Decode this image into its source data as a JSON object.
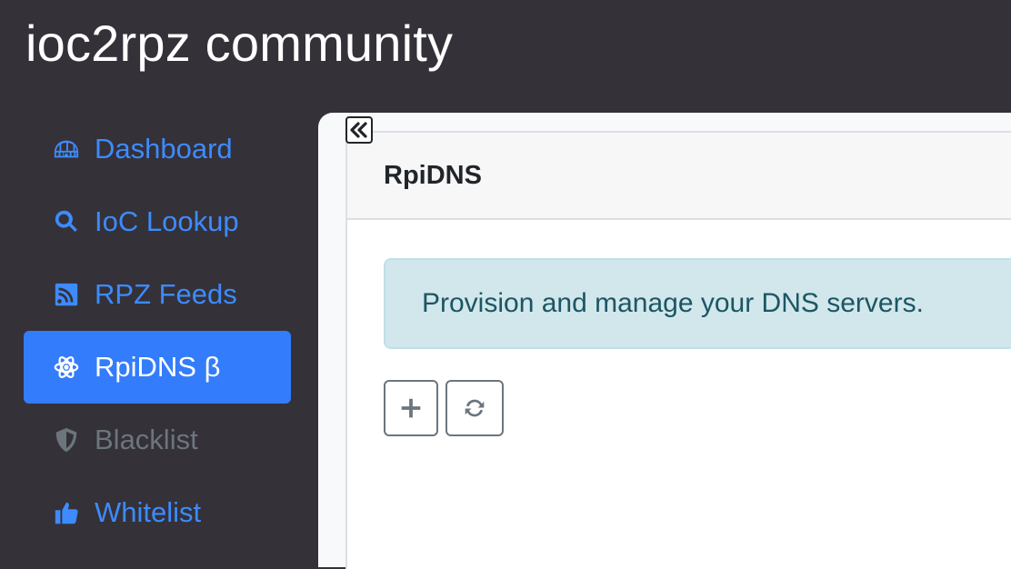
{
  "app": {
    "title": "ioc2rpz community"
  },
  "sidebar": {
    "items": [
      {
        "label": "Dashboard",
        "icon": "igloo-icon",
        "state": "normal"
      },
      {
        "label": "IoC Lookup",
        "icon": "search-icon",
        "state": "normal"
      },
      {
        "label": "RPZ Feeds",
        "icon": "rss-square-icon",
        "state": "normal"
      },
      {
        "label": "RpiDNS β",
        "icon": "atom-icon",
        "state": "active"
      },
      {
        "label": "Blacklist",
        "icon": "shield-icon",
        "state": "disabled"
      },
      {
        "label": "Whitelist",
        "icon": "thumbs-up-icon",
        "state": "normal"
      }
    ]
  },
  "main": {
    "collapse_icon": "double-chevron-left-icon",
    "card": {
      "title": "RpiDNS",
      "info": "Provision and manage your DNS servers.",
      "toolbar": [
        {
          "icon": "plus-icon"
        },
        {
          "icon": "refresh-icon"
        }
      ]
    }
  },
  "colors": {
    "background": "#343139",
    "accent": "#337cfb",
    "link": "#3d8bfd",
    "disabled": "#6c757d",
    "alert_bg": "#d1e7ec",
    "alert_text": "#1c5662"
  }
}
